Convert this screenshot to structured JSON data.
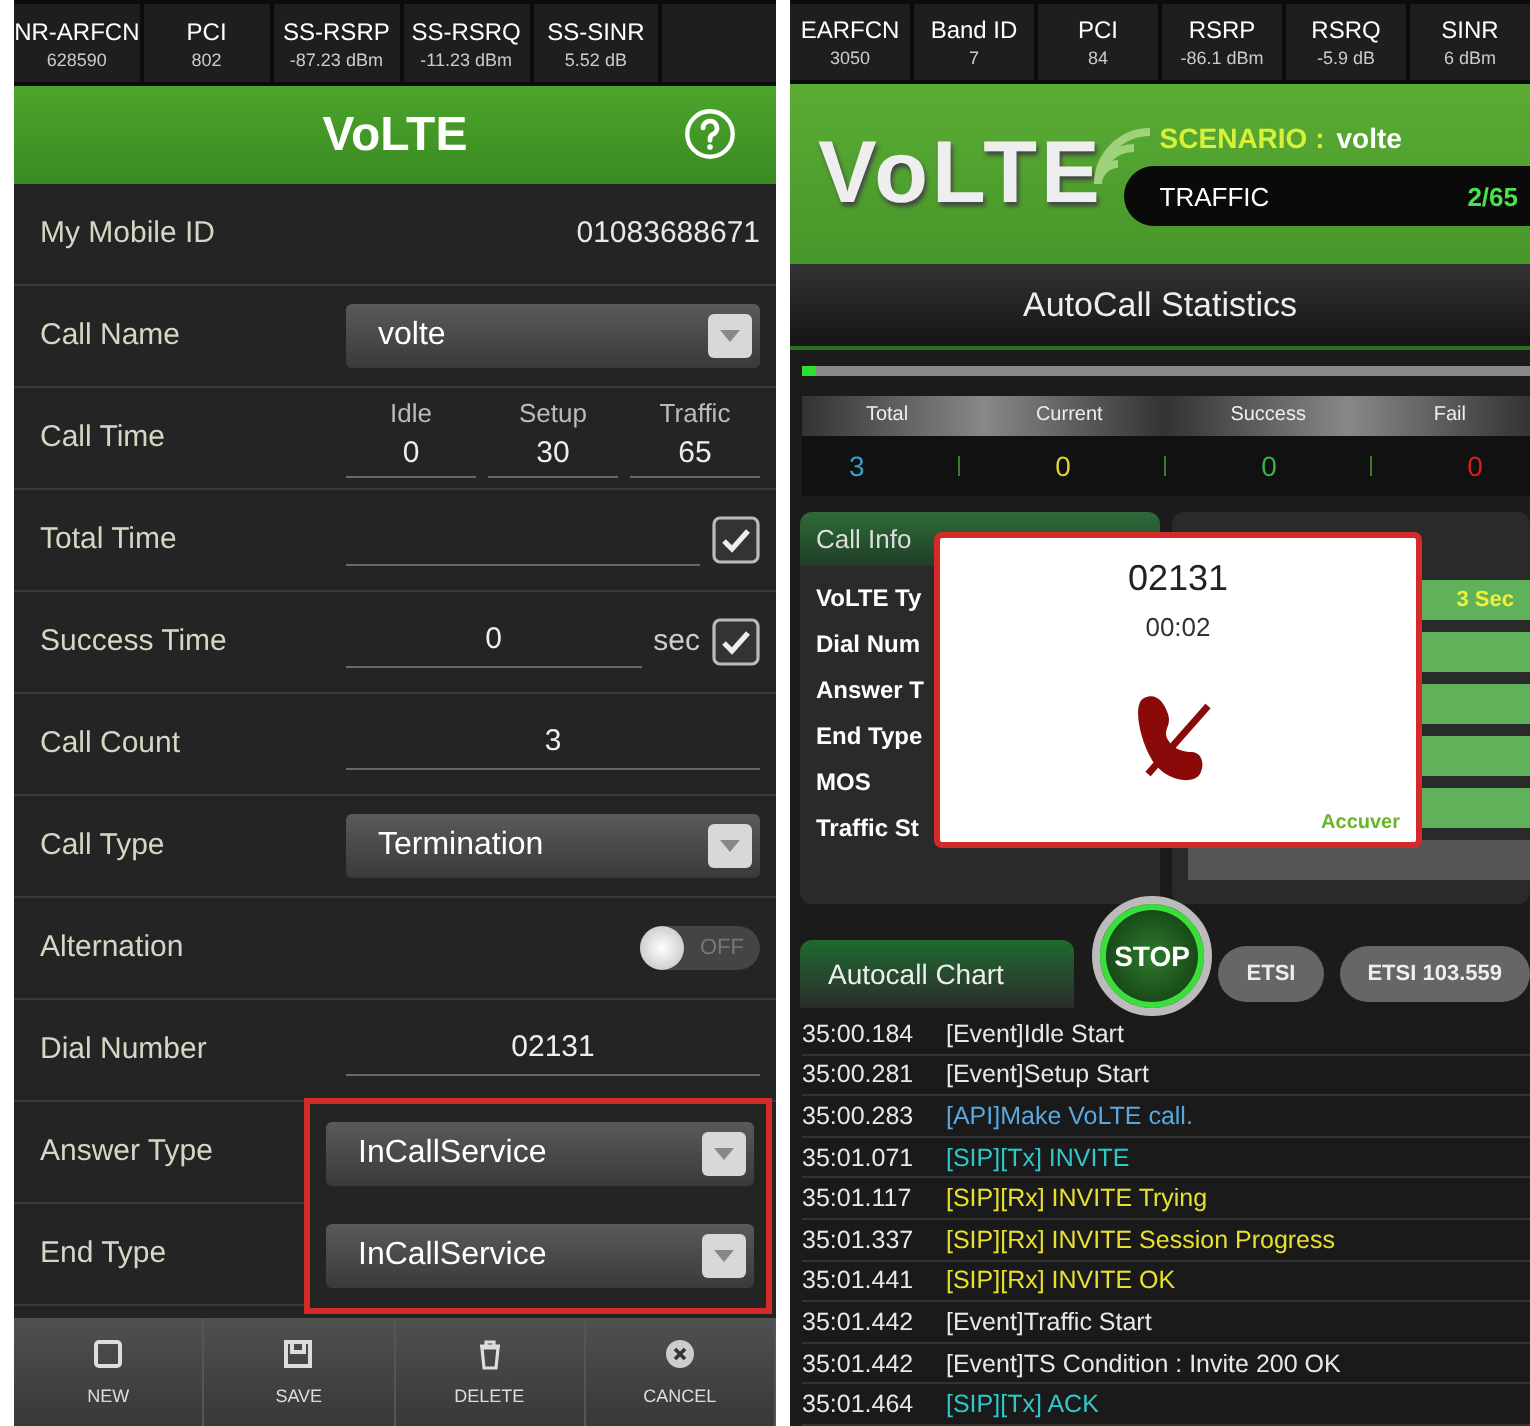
{
  "left": {
    "metrics": [
      {
        "label": "NR-ARFCN",
        "value": "628590"
      },
      {
        "label": "PCI",
        "value": "802"
      },
      {
        "label": "SS-RSRP",
        "value": "-87.23 dBm"
      },
      {
        "label": "SS-RSRQ",
        "value": "-11.23 dBm"
      },
      {
        "label": "SS-SINR",
        "value": "5.52 dB"
      }
    ],
    "title": "VoLTE",
    "rows": [
      {
        "kind": "text",
        "label": "My Mobile ID",
        "value": "01083688671"
      },
      {
        "kind": "dropdown",
        "label": "Call Name",
        "value": "volte"
      },
      {
        "kind": "call_time",
        "label": "Call Time",
        "fields": [
          {
            "label": "Idle",
            "value": "0"
          },
          {
            "label": "Setup",
            "value": "30"
          },
          {
            "label": "Traffic",
            "value": "65"
          }
        ]
      },
      {
        "kind": "field",
        "label": "Total Time",
        "checked": true
      },
      {
        "kind": "field",
        "label": "Success Time",
        "value": "0",
        "unit": "sec",
        "checked": true
      },
      {
        "kind": "field",
        "label": "Call Count",
        "value": "3"
      },
      {
        "kind": "dropdown",
        "label": "Call Type",
        "value": "Termination"
      },
      {
        "kind": "toggle",
        "label": "Alternation",
        "on": false,
        "toggle_text": "OFF"
      },
      {
        "kind": "field",
        "label": "Dial Number",
        "value": "02131"
      }
    ],
    "highlight_box": {
      "rows": [
        {
          "kind": "dropdown",
          "label": "Answer Type",
          "value": "InCallService"
        },
        {
          "kind": "dropdown",
          "label": "End Type",
          "value": "InCallService"
        }
      ]
    },
    "toolbar": [
      {
        "label": "NEW"
      },
      {
        "label": "SAVE"
      },
      {
        "label": "DELETE"
      },
      {
        "label": "CANCEL"
      }
    ]
  },
  "right": {
    "metrics": [
      {
        "label": "EARFCN",
        "value": "3050"
      },
      {
        "label": "Band ID",
        "value": "7"
      },
      {
        "label": "PCI",
        "value": "84"
      },
      {
        "label": "RSRP",
        "value": "-86.1 dBm"
      },
      {
        "label": "RSRQ",
        "value": "-5.9 dB"
      },
      {
        "label": "SINR",
        "value": "6 dBm"
      }
    ],
    "logo": "VoLTE",
    "scenario_label": "SCENARIO :",
    "scenario_value": "volte",
    "traffic_label": "TRAFFIC",
    "traffic_value": "2/65",
    "stats_title": "AutoCall Statistics",
    "progress": {
      "level": 0.02
    },
    "stats": [
      {
        "label": "Total",
        "value": "3",
        "color": "#3a9fc8"
      },
      {
        "label": "Current",
        "value": "0",
        "color": "#e0d030"
      },
      {
        "label": "Success",
        "value": "0",
        "color": "#3cb043"
      },
      {
        "label": "Fail",
        "value": "0",
        "color": "#d02020"
      }
    ],
    "call_info": {
      "tab": "Call Info",
      "labels": [
        "VoLTE Ty",
        "Dial Num",
        "Answer T",
        "End Type",
        "MOS",
        "Traffic St"
      ],
      "status_bars": [
        {
          "kind": "active",
          "text": "3 Sec"
        },
        {
          "kind": "active"
        },
        {
          "kind": "active"
        },
        {
          "kind": "active"
        },
        {
          "kind": "active"
        },
        {
          "kind": "inactive"
        }
      ]
    },
    "popup": {
      "number": "02131",
      "duration": "00:02",
      "brand": "Accuver"
    },
    "chart_tabs": [
      {
        "label": "Autocall Chart",
        "selected": true
      },
      {
        "label": "ETSI",
        "selected": false
      },
      {
        "label": "ETSI 103.559",
        "selected": false
      }
    ],
    "stop_button": "STOP",
    "log": [
      {
        "time": "35:00.184",
        "text": "[Event]Idle Start",
        "kind": "event"
      },
      {
        "time": "35:00.281",
        "text": "[Event]Setup Start",
        "kind": "event"
      },
      {
        "time": "35:00.283",
        "text": "[API]Make VoLTE call.",
        "kind": "api"
      },
      {
        "time": "35:01.071",
        "text": "[SIP][Tx] INVITE",
        "kind": "tx"
      },
      {
        "time": "35:01.117",
        "text": "[SIP][Rx] INVITE Trying",
        "kind": "rx"
      },
      {
        "time": "35:01.337",
        "text": "[SIP][Rx] INVITE Session Progress",
        "kind": "rx"
      },
      {
        "time": "35:01.441",
        "text": "[SIP][Rx] INVITE OK",
        "kind": "rx"
      },
      {
        "time": "35:01.442",
        "text": "[Event]Traffic Start",
        "kind": "event"
      },
      {
        "time": "35:01.442",
        "text": "[Event]TS Condition : Invite 200 OK",
        "kind": "event"
      },
      {
        "time": "35:01.464",
        "text": "[SIP][Tx] ACK",
        "kind": "tx"
      }
    ]
  }
}
